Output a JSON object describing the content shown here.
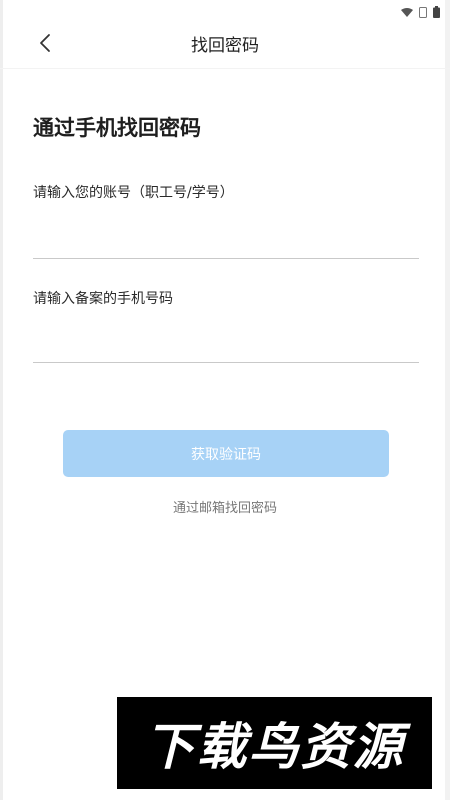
{
  "header": {
    "title": "找回密码"
  },
  "main": {
    "heading": "通过手机找回密码",
    "account_label": "请输入您的账号（职工号/学号）",
    "account_value": "",
    "phone_label": "请输入备案的手机号码",
    "phone_value": "",
    "get_code_label": "获取验证码",
    "email_link": "通过邮箱找回密码"
  },
  "watermark": {
    "text": "下载鸟资源"
  },
  "colors": {
    "primary_disabled": "#a7d2f6",
    "text_dark": "#1e1e1e",
    "link_gray": "#777777"
  },
  "icons": {
    "back": "chevron-left-icon",
    "wifi": "wifi-icon",
    "sim": "sim-icon",
    "battery": "battery-icon"
  }
}
